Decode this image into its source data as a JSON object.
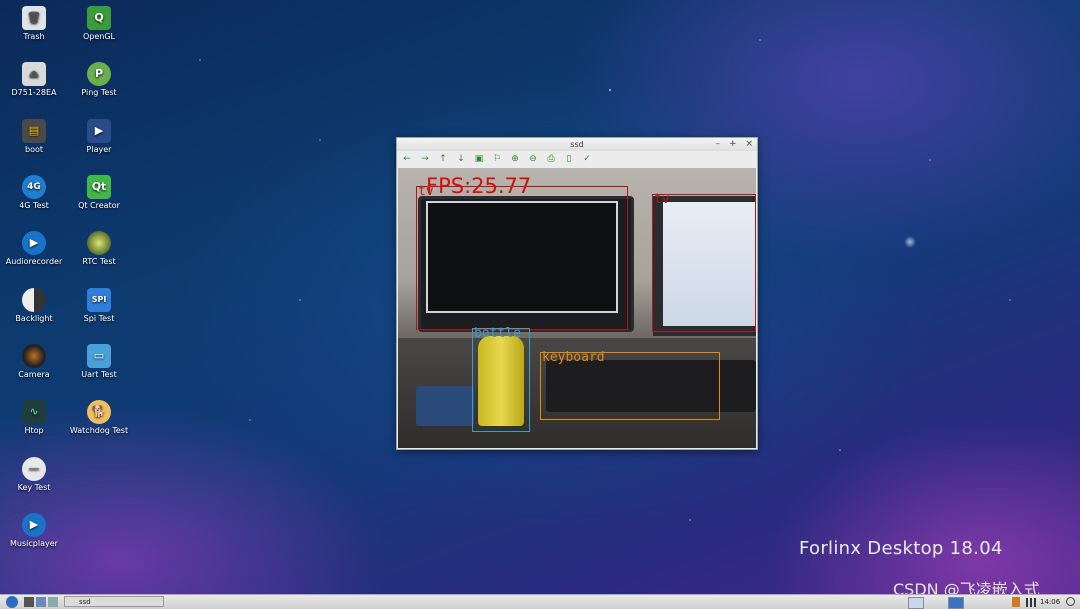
{
  "desktop": {
    "icons": [
      {
        "label": "Trash",
        "icon": "trash-icon"
      },
      {
        "label": "OpenGL",
        "icon": "opengl-icon"
      },
      {
        "label": "D751-28EA",
        "icon": "usb-drive-icon"
      },
      {
        "label": "Ping Test",
        "icon": "ping-icon"
      },
      {
        "label": "boot",
        "icon": "drive-icon"
      },
      {
        "label": "Player",
        "icon": "player-icon"
      },
      {
        "label": "4G Test",
        "icon": "4g-icon"
      },
      {
        "label": "Qt Creator",
        "icon": "qt-icon"
      },
      {
        "label": "Audiorecorder",
        "icon": "audio-icon"
      },
      {
        "label": "RTC Test",
        "icon": "rtc-icon"
      },
      {
        "label": "Backlight",
        "icon": "backlight-icon"
      },
      {
        "label": "Spi Test",
        "icon": "spi-icon"
      },
      {
        "label": "Camera",
        "icon": "camera-icon"
      },
      {
        "label": "Uart Test",
        "icon": "uart-icon"
      },
      {
        "label": "Htop",
        "icon": "htop-icon"
      },
      {
        "label": "Watchdog Test",
        "icon": "watchdog-icon"
      },
      {
        "label": "Key Test",
        "icon": "key-icon"
      },
      {
        "label": "Musicplayer",
        "icon": "music-icon"
      }
    ],
    "watermark": "Forlinx Desktop 18.04",
    "csdn": "CSDN @飞凌嵌入式"
  },
  "window": {
    "title": "ssd",
    "controls": [
      "–",
      "+",
      "×"
    ],
    "toolbar": [
      "←",
      "→",
      "↑",
      "↓",
      "▣",
      "⚐",
      "⊕",
      "⊖",
      "⎙",
      "▯",
      "✓"
    ],
    "fps": "FPS:25.77",
    "detections": [
      {
        "label": "tv",
        "color": "#b01818"
      },
      {
        "label": "tv",
        "color": "#b01818"
      },
      {
        "label": "bottle",
        "color": "#3aa0c8"
      },
      {
        "label": "keyboard",
        "color": "#e08a10"
      }
    ]
  },
  "taskbar": {
    "task": "ssd",
    "clock": "14:06"
  }
}
